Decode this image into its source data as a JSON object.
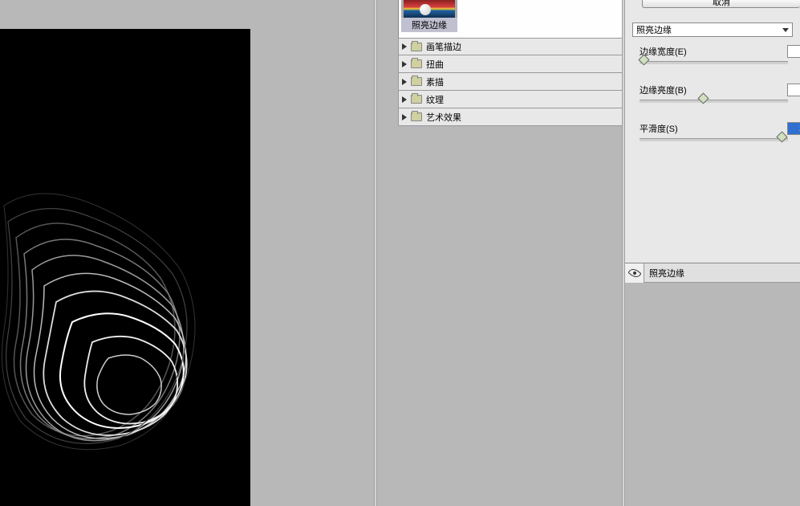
{
  "preview": {
    "filter_thumb_label": "照亮边缘"
  },
  "categories": [
    {
      "label": "画笔描边"
    },
    {
      "label": "扭曲"
    },
    {
      "label": "素描"
    },
    {
      "label": "纹理"
    },
    {
      "label": "艺术效果"
    }
  ],
  "controls": {
    "cancel_button": "取消",
    "filter_select": "照亮边缘",
    "sliders": [
      {
        "label": "边缘宽度(E)",
        "value": "1",
        "pos": 2,
        "highlighted": false
      },
      {
        "label": "边缘亮度(B)",
        "value": "8",
        "pos": 42,
        "highlighted": false
      },
      {
        "label": "平滑度(S)",
        "value": "15",
        "pos": 95,
        "highlighted": true
      }
    ]
  },
  "effects_layer": {
    "name": "照亮边缘"
  }
}
